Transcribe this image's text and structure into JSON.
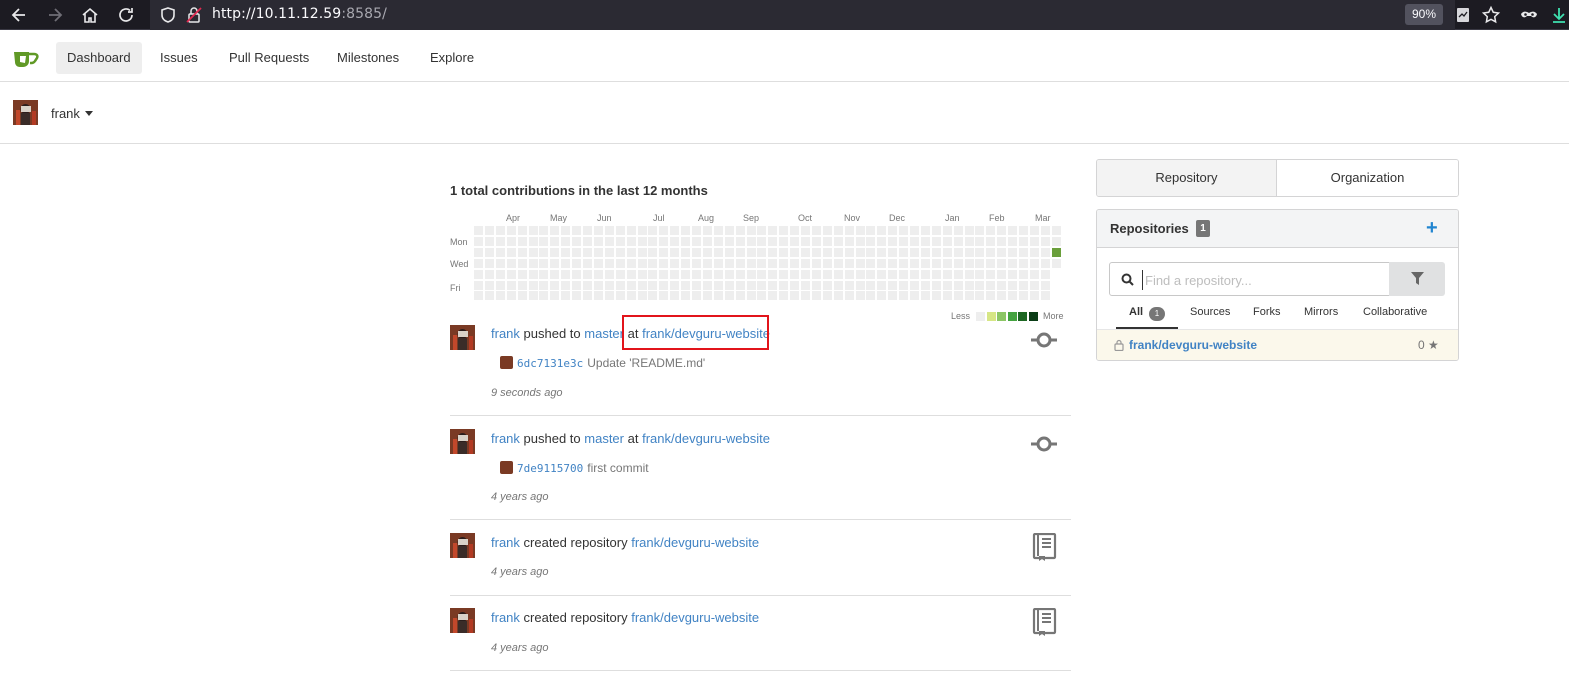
{
  "browser": {
    "url_host": "http://10.11.12.59",
    "url_port": ":8585/",
    "zoom": "90%"
  },
  "nav": {
    "items": [
      {
        "label": "Dashboard",
        "active": true
      },
      {
        "label": "Issues"
      },
      {
        "label": "Pull Requests"
      },
      {
        "label": "Milestones"
      },
      {
        "label": "Explore"
      }
    ]
  },
  "context": {
    "user": "frank"
  },
  "heatmap": {
    "title": "1 total contributions in the last 12 months",
    "months": [
      "Apr",
      "May",
      "Jun",
      "Jul",
      "Aug",
      "Sep",
      "Oct",
      "Nov",
      "Dec",
      "Jan",
      "Feb",
      "Mar"
    ],
    "days": [
      "Mon",
      "Wed",
      "Fri"
    ],
    "legend_less": "Less",
    "legend_more": "More",
    "colors": {
      "empty": "#eeeeee",
      "l1": "#d6e685",
      "l2": "#8cc665",
      "l3": "#44a340",
      "l4": "#1e6823",
      "active": "#6a9f3b"
    }
  },
  "feed": [
    {
      "user": "frank",
      "action": "pushed to",
      "branch": "master",
      "at": "at",
      "repo": "frank/devguru-website",
      "commit_sha": "6dc7131e3c",
      "commit_msg": "Update 'README.md'",
      "time": "9 seconds ago",
      "icon": "commit-icon"
    },
    {
      "user": "frank",
      "action": "pushed to",
      "branch": "master",
      "at": "at",
      "repo": "frank/devguru-website",
      "commit_sha": "7de9115700",
      "commit_msg": "first commit",
      "time": "4 years ago",
      "icon": "commit-icon"
    },
    {
      "user": "frank",
      "action": "created repository",
      "repo": "frank/devguru-website",
      "time": "4 years ago",
      "icon": "book-icon"
    },
    {
      "user": "frank",
      "action": "created repository",
      "repo": "frank/devguru-website",
      "time": "4 years ago",
      "icon": "book-icon"
    }
  ],
  "side": {
    "tab_repository": "Repository",
    "tab_organization": "Organization",
    "repos_title": "Repositories",
    "repos_count": "1",
    "add": "+",
    "search_placeholder": "Find a repository...",
    "filters": [
      {
        "label": "All",
        "count": "1"
      },
      {
        "label": "Sources"
      },
      {
        "label": "Forks"
      },
      {
        "label": "Mirrors"
      },
      {
        "label": "Collaborative"
      }
    ],
    "repo_name": "frank/devguru-website",
    "repo_stars": "0"
  }
}
